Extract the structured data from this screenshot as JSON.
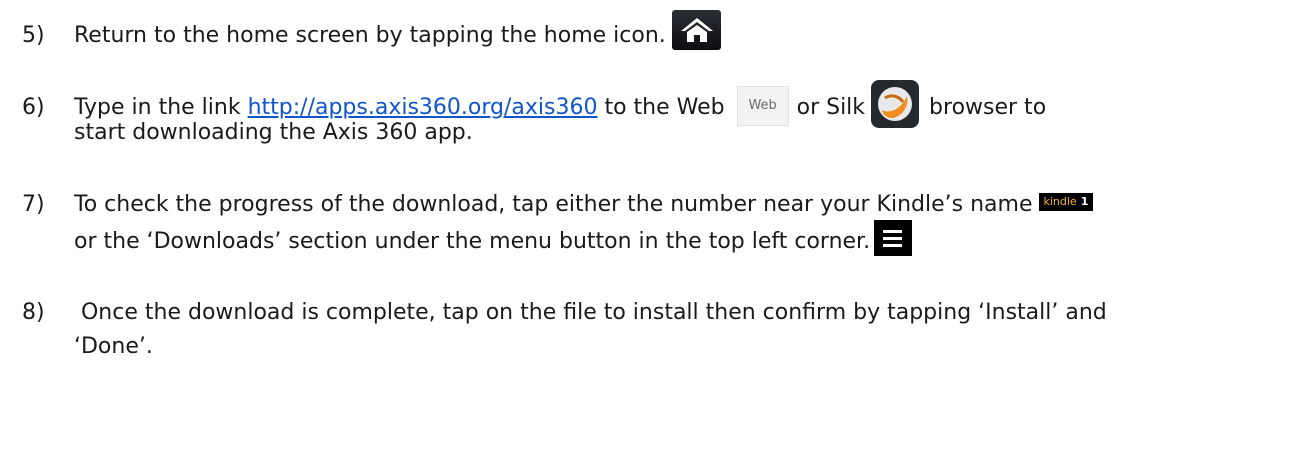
{
  "steps": [
    {
      "number": "5)",
      "text_before_icon": "Return to the home screen by tapping the home icon."
    },
    {
      "number": "6)",
      "text_prefix": "Type in the link ",
      "link": "http://apps.axis360.org/axis360",
      "text_middle": " to the Web",
      "web_icon_label": "Web",
      "text_or": "or Silk",
      "text_after": "browser to",
      "continuation": "start downloading the Axis 360 app."
    },
    {
      "number": "7)",
      "text": "To check the progress of the download, tap either the number near your Kindle’s name",
      "kindle_badge_label": "kindle",
      "kindle_badge_count": "1",
      "continuation": "or the ‘Downloads’ section under the menu button in the top left corner."
    },
    {
      "number": "8)",
      "text": " Once the download is complete, tap on the file to install then confirm by tapping ‘Install’ and",
      "continuation": "‘Done’."
    }
  ],
  "icons": {
    "home": "home-icon",
    "web": "web-browser-icon",
    "silk": "silk-browser-icon",
    "menu": "menu-icon"
  },
  "colors": {
    "link": "#1155cc",
    "kindle_badge_text": "#f3b240",
    "silk_orange": "#f28c1c"
  }
}
